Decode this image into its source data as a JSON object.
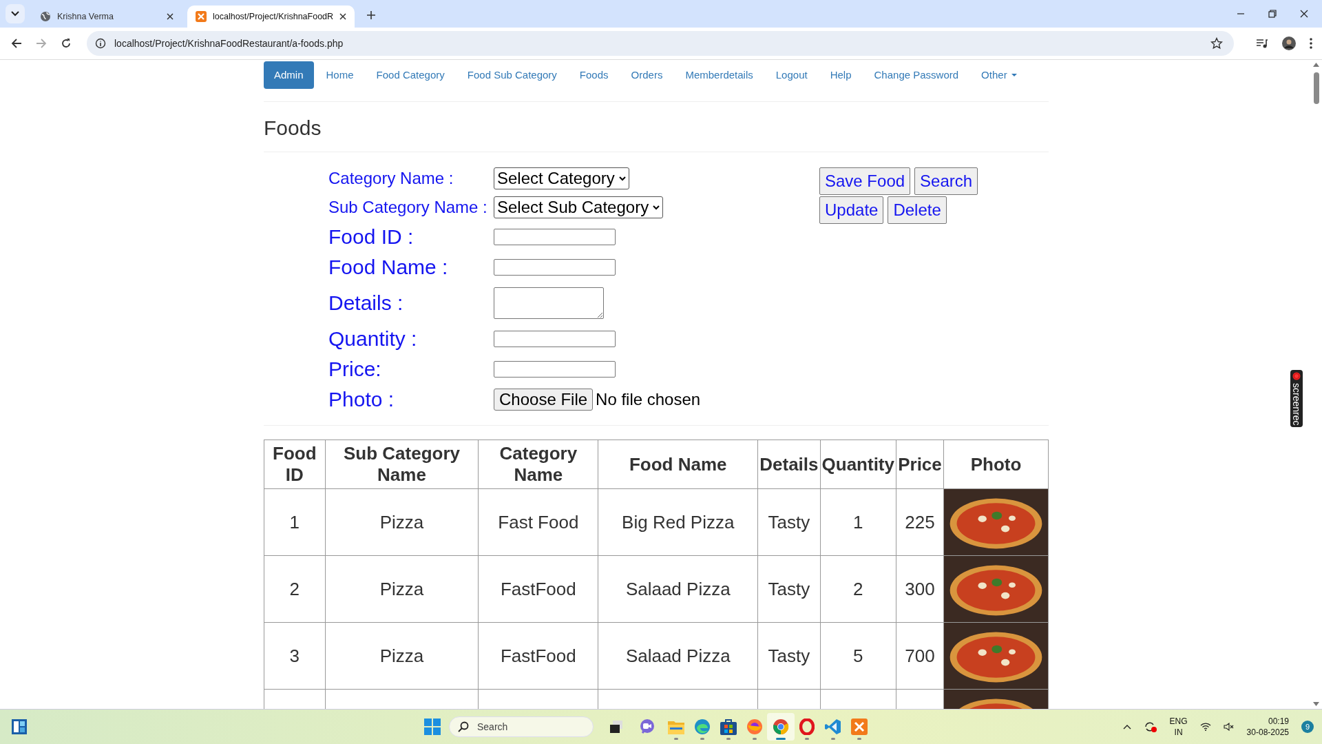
{
  "browser": {
    "tabs": [
      {
        "title": "Krishna Verma",
        "selected": false,
        "kind": "globe"
      },
      {
        "title": "localhost/Project/KrishnaFoodR",
        "selected": true,
        "kind": "xampp"
      }
    ],
    "url": "localhost/Project/KrishnaFoodRestaurant/a-foods.php"
  },
  "nav": [
    {
      "label": "Admin",
      "selected": true
    },
    {
      "label": "Home",
      "selected": false
    },
    {
      "label": "Food Category",
      "selected": false
    },
    {
      "label": "Food Sub Category",
      "selected": false
    },
    {
      "label": "Foods",
      "selected": false
    },
    {
      "label": "Orders",
      "selected": false
    },
    {
      "label": "Memberdetails",
      "selected": false
    },
    {
      "label": "Logout",
      "selected": false
    },
    {
      "label": "Help",
      "selected": false
    },
    {
      "label": "Change Password",
      "selected": false
    },
    {
      "label": "Other",
      "selected": false,
      "kind": "dropdown"
    }
  ],
  "heading": "Foods",
  "form": {
    "fields": [
      {
        "label": "Category Name :",
        "kind": "select",
        "value": "Select Category"
      },
      {
        "label": "Sub Category Name :",
        "kind": "select",
        "value": "Select Sub Category"
      },
      {
        "label": "Food ID :",
        "kind": "text"
      },
      {
        "label": "Food Name :",
        "kind": "text"
      },
      {
        "label": "Details :",
        "kind": "textarea"
      },
      {
        "label": "Quantity :",
        "kind": "text"
      },
      {
        "label": "Price:",
        "kind": "text"
      },
      {
        "label": "Photo :",
        "kind": "file",
        "button": "Choose File",
        "value": "No file chosen"
      }
    ],
    "buttons": [
      [
        "Save Food",
        "Search"
      ],
      [
        "Update",
        "Delete"
      ]
    ]
  },
  "table": {
    "columns": [
      "Food ID",
      "Sub Category Name",
      "Category Name",
      "Food Name",
      "Details",
      "Quantity",
      "Price",
      "Photo"
    ],
    "rows": [
      {
        "cells": [
          "1",
          "Pizza",
          "Fast Food",
          "Big Red Pizza",
          "Tasty",
          "1",
          "225"
        ],
        "photo": true
      },
      {
        "cells": [
          "2",
          "Pizza",
          "FastFood",
          "Salaad Pizza",
          "Tasty",
          "2",
          "300"
        ],
        "photo": true
      },
      {
        "cells": [
          "3",
          "Pizza",
          "FastFood",
          "Salaad Pizza",
          "Tasty",
          "5",
          "700"
        ],
        "photo": true
      },
      {
        "cells": [],
        "photo": true
      }
    ]
  },
  "overlay": {
    "label": "screenrec"
  },
  "taskbar": {
    "search": {
      "placeholder": "Search"
    },
    "apps": [
      {
        "kind": "files",
        "selected": false
      },
      {
        "kind": "edge",
        "selected": false
      },
      {
        "kind": "store",
        "selected": false
      },
      {
        "kind": "firefox",
        "selected": false
      },
      {
        "kind": "chrome",
        "selected": true
      },
      {
        "kind": "opera",
        "selected": false
      },
      {
        "kind": "vscode",
        "selected": false
      },
      {
        "kind": "xampp",
        "selected": false
      }
    ],
    "language": [
      "ENG",
      "IN"
    ],
    "time": "00:19",
    "date": "30-08-2025",
    "notifications": "9"
  }
}
